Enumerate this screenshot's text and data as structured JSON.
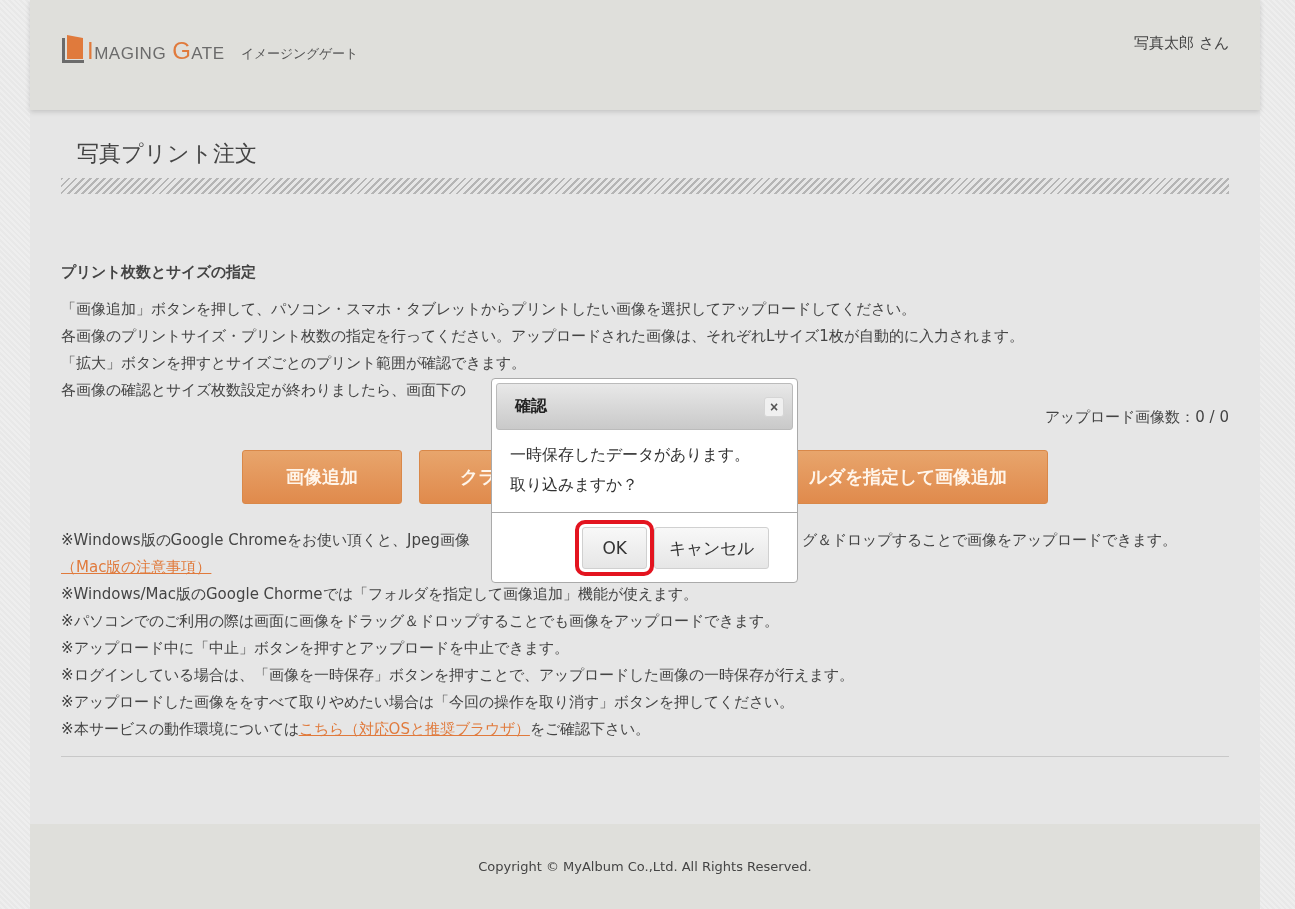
{
  "header": {
    "logo_words": [
      "IMAGING",
      "GATE"
    ],
    "logo_subtitle": "イメージングゲート",
    "user": "写真太郎 さん"
  },
  "page_title": "写真プリント注文",
  "section": {
    "heading": "プリント枚数とサイズの指定",
    "lines": [
      "「画像追加」ボタンを押して、パソコン・スマホ・タブレットからプリントしたい画像を選択してアップロードしてください。",
      "各画像のプリントサイズ・プリント枚数の指定を行ってください。アップロードされた画像は、それぞれLサイズ1枚が自動的に入力されます。",
      "「拡大」ボタンを押すとサイズごとのプリント範囲が確認できます。",
      "各画像の確認とサイズ枚数設定が終わりましたら、画面下の"
    ],
    "upload_count": "アップロード画像数：0 / 0"
  },
  "buttons": [
    {
      "label": "画像追加"
    },
    {
      "label": "クラ"
    },
    {
      "label": "ルダを指定して画像追加"
    }
  ],
  "notes": [
    {
      "kind": "split",
      "left": "※Windows版のGoogle Chromeをお使い頂くと、Jpeg画像",
      "right": "グ＆ドロップすることで画像をアップロードできます。"
    },
    {
      "kind": "link",
      "text": "（Mac版の注意事項）"
    },
    {
      "kind": "plain",
      "text": "※Windows/Mac版のGoogle Chormeでは「フォルダを指定して画像追加」機能が使えます。"
    },
    {
      "kind": "plain",
      "text": "※パソコンでのご利用の際は画面に画像をドラッグ＆ドロップすることでも画像をアップロードできます。"
    },
    {
      "kind": "plain",
      "text": "※アップロード中に「中止」ボタンを押すとアップロードを中止できます。"
    },
    {
      "kind": "plain",
      "text": "※ログインしている場合は、「画像を一時保存」ボタンを押すことで、アップロードした画像の一時保存が行えます。"
    },
    {
      "kind": "plain",
      "text": "※アップロードした画像ををすべて取りやめたい場合は「今回の操作を取り消す」ボタンを押してください。"
    },
    {
      "kind": "inline_link",
      "before": "※本サービスの動作環境については",
      "link": "こちら（対応OSと推奨ブラウザ）",
      "after": "をご確認下さい。"
    }
  ],
  "footer": "Copyright © MyAlbum Co.,Ltd. All Rights Reserved.",
  "dialog": {
    "title": "確認",
    "close": "×",
    "message": [
      "一時保存したデータがあります。",
      "取り込みますか？"
    ],
    "buttons": [
      {
        "label": "OK",
        "highlighted": true
      },
      {
        "label": "キャンセル",
        "highlighted": false
      }
    ]
  }
}
